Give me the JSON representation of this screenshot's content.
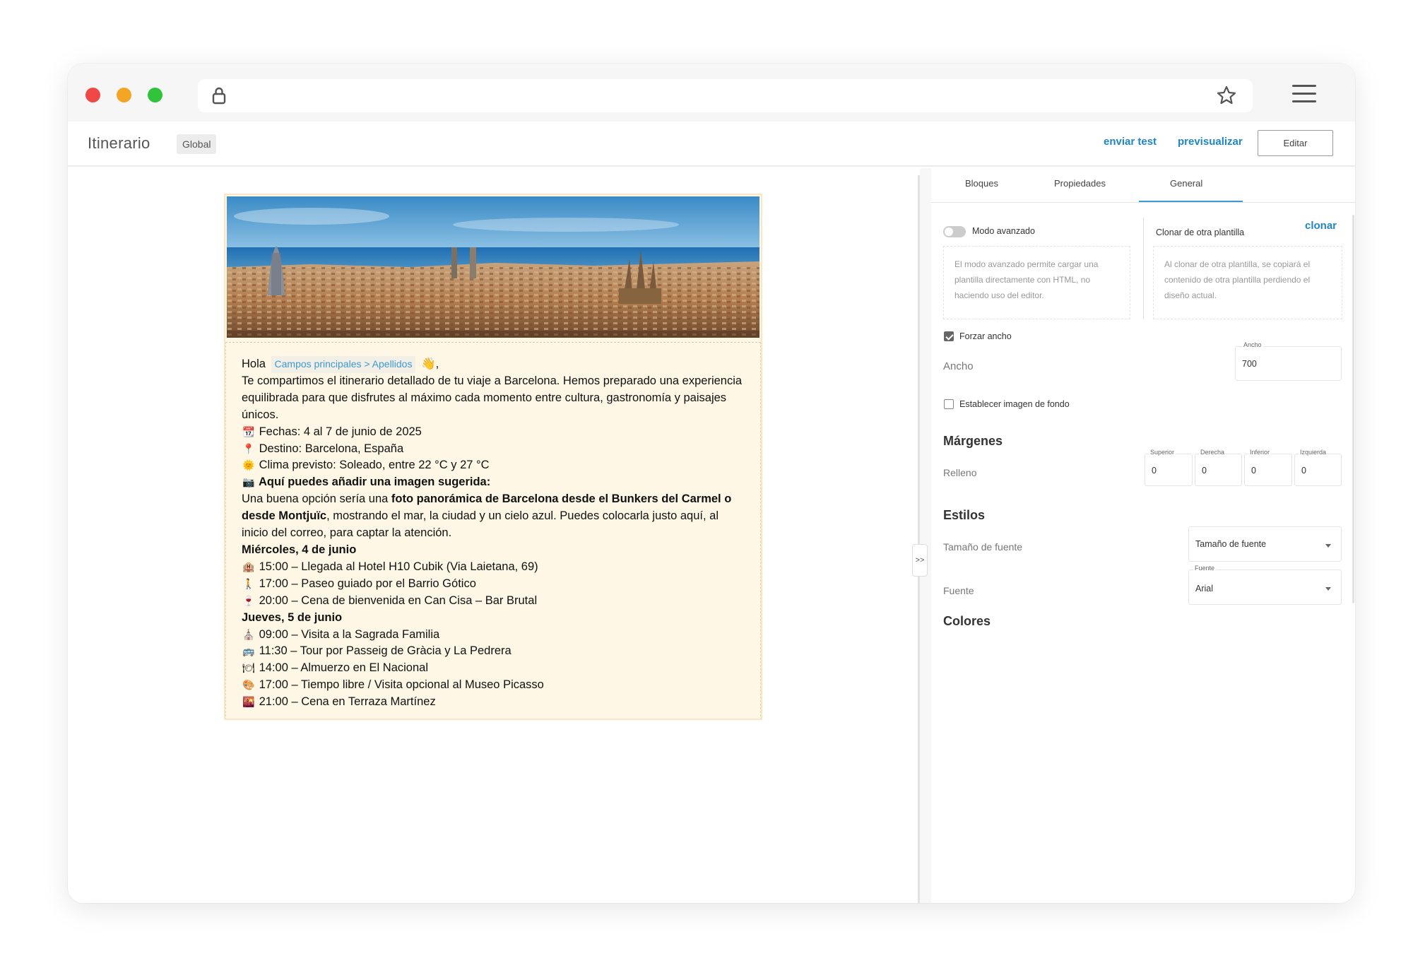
{
  "app": {
    "title": "Itinerario",
    "badge": "Global",
    "send_test": "enviar test",
    "preview": "previsualizar",
    "edit": "Editar"
  },
  "browser": {
    "icons": [
      "lock-icon",
      "star-icon",
      "hamburger-menu-icon"
    ]
  },
  "email": {
    "hero_alt": "Panorámica de Barcelona",
    "greeting": "Hola",
    "merge_tag": "Campos principales > Apellidos",
    "greeting_tail": "👋,",
    "intro": "Te compartimos el itinerario detallado de tu viaje a Barcelona. Hemos preparado una experiencia equilibrada para que disfrutes al máximo cada momento entre cultura, gastronomía y paisajes únicos.",
    "facts": [
      {
        "icon": "📆",
        "text": "Fechas: 4 al 7 de junio de 2025"
      },
      {
        "icon": "📍",
        "text": "Destino: Barcelona, España"
      },
      {
        "icon": "🌞",
        "text": "Clima previsto: Soleado, entre 22 °C y 27 °C"
      }
    ],
    "image_tip_icon": "📷",
    "image_tip_title": "Aquí puedes añadir una imagen sugerida:",
    "image_tip_a": "Una buena opción sería una ",
    "image_tip_bold": "foto panorámica de Barcelona desde el Bunkers del Carmel o desde Montjuïc",
    "image_tip_b": ", mostrando el mar, la ciudad y un cielo azul. Puedes colocarla justo aquí, al inicio del correo, para captar la atención.",
    "days": [
      {
        "title": "Miércoles, 4 de junio",
        "items": [
          {
            "icon": "🏨",
            "text": "15:00 – Llegada al Hotel H10 Cubik (Via Laietana, 69)"
          },
          {
            "icon": "🚶",
            "text": "17:00 – Paseo guiado por el Barrio Gótico"
          },
          {
            "icon": "🍷",
            "text": "20:00 – Cena de bienvenida en Can Cisa – Bar Brutal"
          }
        ]
      },
      {
        "title": "Jueves, 5 de junio",
        "items": [
          {
            "icon": "⛪",
            "text": "09:00 – Visita a la Sagrada Familia"
          },
          {
            "icon": "🚌",
            "text": "11:30 – Tour por Passeig de Gràcia y La Pedrera"
          },
          {
            "icon": "🍽",
            "text": "14:00 – Almuerzo en El Nacional"
          },
          {
            "icon": "🎨",
            "text": "17:00 – Tiempo libre / Visita opcional al Museo Picasso"
          },
          {
            "icon": "🌇",
            "text": "21:00 – Cena en Terraza Martínez"
          }
        ]
      }
    ]
  },
  "panel": {
    "tabs": [
      "Bloques",
      "Propiedades",
      "General"
    ],
    "active_tab": "General",
    "advanced_mode": {
      "label": "Modo avanzado",
      "enabled": false,
      "help": "El modo avanzado permite cargar una plantilla directamente con HTML, no haciendo uso del editor."
    },
    "clone": {
      "label": "Clonar de otra plantilla",
      "action": "clonar",
      "help": "Al clonar de otra plantilla, se copiará el contenido de otra plantilla perdiendo el diseño actual."
    },
    "force_width": {
      "label": "Forzar ancho",
      "checked": true
    },
    "width": {
      "label": "Ancho",
      "field_label": "Ancho",
      "value": "700"
    },
    "background_image": {
      "label": "Establecer imagen de fondo",
      "checked": false
    },
    "margins": {
      "title": "Márgenes",
      "row_label": "Relleno",
      "fields": [
        {
          "label": "Superior",
          "value": "0"
        },
        {
          "label": "Derecha",
          "value": "0"
        },
        {
          "label": "Inferior",
          "value": "0"
        },
        {
          "label": "Izquierda",
          "value": "0"
        }
      ]
    },
    "styles": {
      "title": "Estilos",
      "font_size_label": "Tamaño de fuente",
      "font_size_value": "Tamaño de fuente",
      "font_label": "Fuente",
      "font_field_label": "Fuente",
      "font_value": "Arial"
    },
    "colors": {
      "title": "Colores"
    },
    "collapse": ">>"
  },
  "colors": {
    "accent": "#1f86c2",
    "email_bg": "#fef7e6",
    "email_border": "#fbe6c4"
  }
}
